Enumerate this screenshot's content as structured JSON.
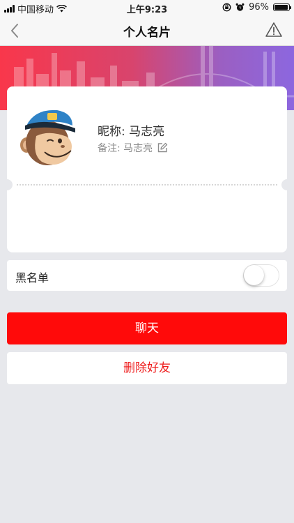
{
  "status_bar": {
    "carrier": "中国移动",
    "time": "上午9:23",
    "battery_percent": "96%",
    "battery_level": 0.96
  },
  "nav": {
    "title": "个人名片",
    "back_icon": "chevron-left-icon",
    "report_icon": "warning-triangle-icon"
  },
  "profile": {
    "nickname": "昵称: 马志亮",
    "remark": "备注: 马志亮",
    "avatar_icon": "monkey-mascot-avatar",
    "edit_icon": "edit-pencil-icon"
  },
  "blacklist": {
    "label": "黑名单",
    "enabled": false
  },
  "actions": {
    "chat_label": "聊天",
    "delete_label": "删除好友"
  },
  "colors": {
    "accent_red": "#ff0a0a",
    "delete_text": "#ee1c1c",
    "banner_start": "#f9374b",
    "banner_end": "#8c67df",
    "background": "#e7e8ec"
  }
}
